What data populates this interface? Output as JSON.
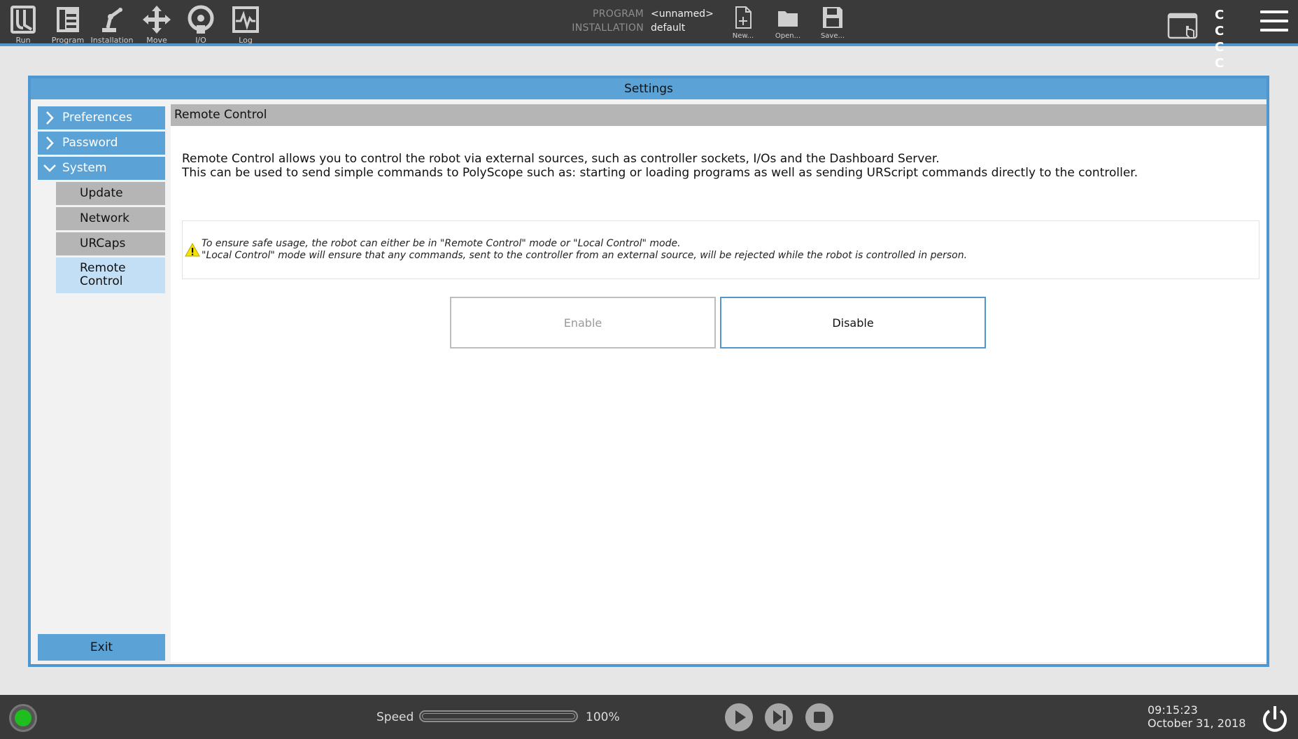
{
  "topbar": {
    "nav": [
      {
        "label": "Run",
        "icon": "ur-logo-icon"
      },
      {
        "label": "Program",
        "icon": "program-icon"
      },
      {
        "label": "Installation",
        "icon": "robot-arm-icon"
      },
      {
        "label": "Move",
        "icon": "move-arrows-icon"
      },
      {
        "label": "I/O",
        "icon": "io-icon"
      },
      {
        "label": "Log",
        "icon": "log-icon"
      }
    ],
    "program_key": "PROGRAM",
    "program_value": "<unnamed>",
    "installation_key": "INSTALLATION",
    "installation_value": "default",
    "file": {
      "new_label": "New...",
      "open_label": "Open...",
      "save_label": "Save..."
    },
    "cccc": "C C C C"
  },
  "settings": {
    "title": "Settings",
    "menu": {
      "preferences": "Preferences",
      "password": "Password",
      "system": "System",
      "update": "Update",
      "network": "Network",
      "urcaps": "URCaps",
      "remote_control": "Remote Control",
      "exit": "Exit"
    },
    "content": {
      "title": "Remote Control",
      "desc_line1": "Remote Control allows you to control the robot via external sources, such as controller sockets, I/Os and the Dashboard Server.",
      "desc_line2": "This can be used to send simple commands to PolyScope such as: starting or loading programs as well as sending URScript commands directly to the controller.",
      "warn_line1": "To ensure safe usage, the robot can either be in \"Remote Control\" mode or \"Local Control\" mode.",
      "warn_line2": "\"Local Control\" mode will ensure that any commands, sent to the controller from an external source, will be rejected while the robot is controlled in person.",
      "enable_label": "Enable",
      "disable_label": "Disable"
    }
  },
  "bottombar": {
    "speed_label": "Speed",
    "speed_value": "100%",
    "speed_fraction": 1.0,
    "time": "09:15:23",
    "date": "October 31, 2018",
    "status_color": "#1fbd1f"
  },
  "colors": {
    "accent": "#5ba3d6",
    "topbar": "#3a3a3a"
  }
}
